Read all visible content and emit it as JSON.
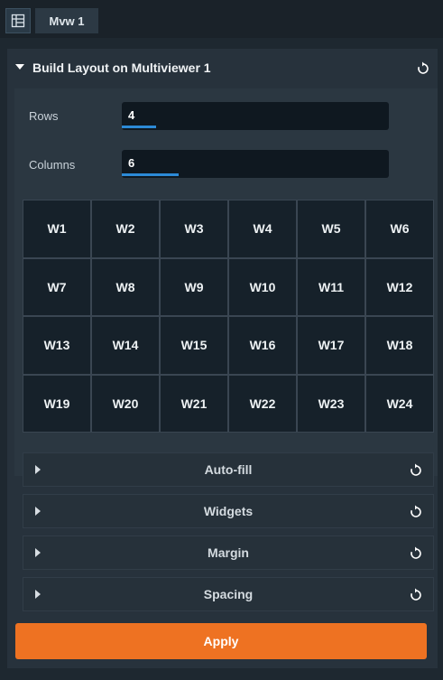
{
  "tab": {
    "label": "Mvw 1"
  },
  "panel": {
    "title": "Build Layout on Multiviewer 1"
  },
  "rows": {
    "label": "Rows",
    "value": "4"
  },
  "columns": {
    "label": "Columns",
    "value": "6"
  },
  "grid": {
    "cells": [
      "W1",
      "W2",
      "W3",
      "W4",
      "W5",
      "W6",
      "W7",
      "W8",
      "W9",
      "W10",
      "W11",
      "W12",
      "W13",
      "W14",
      "W15",
      "W16",
      "W17",
      "W18",
      "W19",
      "W20",
      "W21",
      "W22",
      "W23",
      "W24"
    ]
  },
  "sections": [
    {
      "label": "Auto-fill"
    },
    {
      "label": "Widgets"
    },
    {
      "label": "Margin"
    },
    {
      "label": "Spacing"
    }
  ],
  "apply": {
    "label": "Apply"
  },
  "colors": {
    "accent": "#ee7222",
    "input_focus": "#2c8ad6",
    "background": "#1e2830"
  }
}
